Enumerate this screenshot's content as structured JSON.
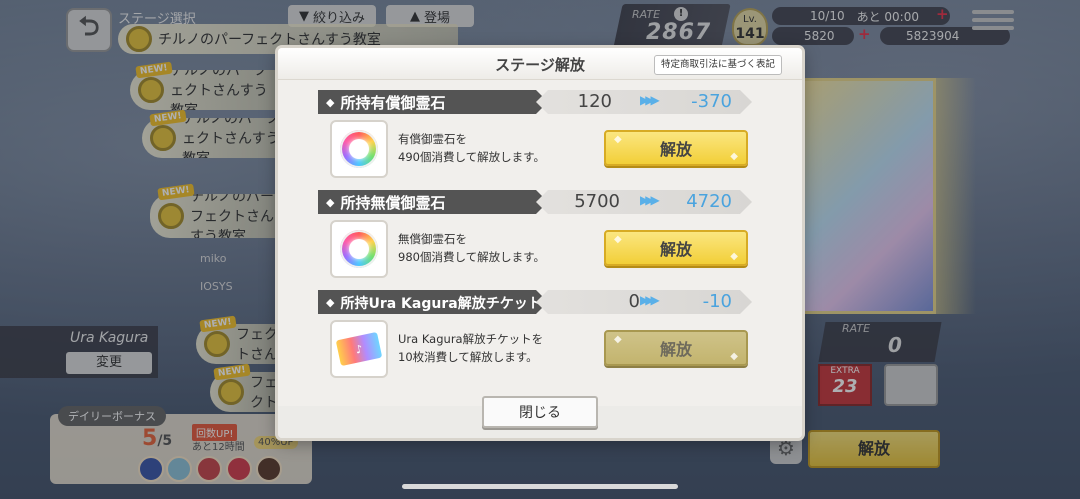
{
  "background": {
    "screen_title": "ステージ選択",
    "filter_label": "絞り込み",
    "sort_label": "登場",
    "rate_label": "RATE",
    "rate_value": "2867",
    "level_label": "Lv.",
    "level_value": "141",
    "stamina": "10/10",
    "stamina_timer": "あと 00:00",
    "currency_a": "5820",
    "currency_b": "5823904",
    "song_rows": [
      "チルノのパーフェクトさんすう教室",
      "チルノのパーフェクトさんすう教室",
      "チルノのパーフェクトさんすう教室",
      "チルノのパーフェクトさんすう教室",
      "チルノのパーフェクトさんすう教室",
      "チルノのパーフェクトさんすう教室"
    ],
    "new_tag": "NEW!",
    "credit_1": "miko",
    "credit_2": "IOSYS",
    "difficulty_name": "Ura Kagura",
    "change_label": "変更",
    "daily_bonus_label": "デイリーボーナス",
    "daily_count": "5",
    "daily_total": "/5",
    "bonus_up_label": "回数UP!",
    "bonus_time": "あと12時間",
    "bonus_pct": "40%UP",
    "rate_right_label": "RATE",
    "rate_right_value": "0",
    "extra_label": "EXTRA",
    "extra_value": "23",
    "bg_unlock_label": "解放"
  },
  "modal": {
    "title": "ステージ解放",
    "law_button": "特定商取引法に基づく表記",
    "sections": [
      {
        "label": "所持有償御霊石",
        "current": "120",
        "after": "-370",
        "item_type": "gem",
        "desc_line1": "有償御霊石を",
        "desc_line2": "490個消費して解放します。",
        "button": "解放",
        "enabled": true
      },
      {
        "label": "所持無償御霊石",
        "current": "5700",
        "after": "4720",
        "item_type": "gem",
        "desc_line1": "無償御霊石を",
        "desc_line2": "980個消費して解放します。",
        "button": "解放",
        "enabled": true
      },
      {
        "label": "所持Ura Kagura解放チケット",
        "current": "0",
        "after": "-10",
        "item_type": "ticket",
        "desc_line1": "Ura Kagura解放チケットを",
        "desc_line2": "10枚消費して解放します。",
        "button": "解放",
        "enabled": false
      }
    ],
    "close_label": "閉じる"
  },
  "colors": {
    "accent_blue": "#4aa3de",
    "button_gold": "#f2cf38",
    "label_dark": "#545454"
  },
  "icons": [
    "back-arrow-icon",
    "filter-icon",
    "triangle-up-icon",
    "info-icon",
    "plus-icon",
    "menu-icon",
    "gem-icon",
    "ticket-icon",
    "gear-icon"
  ]
}
